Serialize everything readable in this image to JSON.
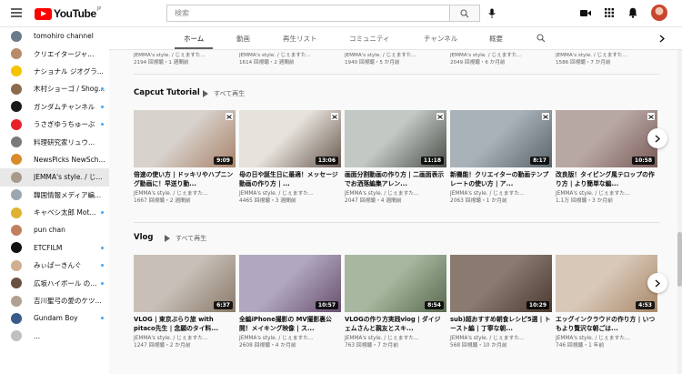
{
  "header": {
    "logo_text": "YouTube",
    "logo_country": "JP",
    "search_placeholder": "検索"
  },
  "sidebar": {
    "items": [
      {
        "label": "tomohiro channel",
        "color": "#6b7b8c",
        "dot": false
      },
      {
        "label": "クリエイタージャ...",
        "color": "#b78a6a",
        "dot": false
      },
      {
        "label": "ナショナル ジオグラ...",
        "color": "#f5c400",
        "dot": false
      },
      {
        "label": "木村ショーゴ / Shog...",
        "color": "#8c6a4e",
        "dot": true
      },
      {
        "label": "ガンダムチャンネル",
        "color": "#1a1a1a",
        "dot": true
      },
      {
        "label": "うさぎゆうちゅーぶ",
        "color": "#e8222a",
        "dot": true
      },
      {
        "label": "料理研究家リュウ...",
        "color": "#7a7a7a",
        "dot": false
      },
      {
        "label": "NewsPicks NewSch...",
        "color": "#d98a2a",
        "dot": false
      },
      {
        "label": "JEMMA's style. / じ...",
        "color": "#a89a8a",
        "dot": false
      },
      {
        "label": "韓国情報メディア編...",
        "color": "#9aa6b0",
        "dot": false
      },
      {
        "label": "キャベシ太郎 Mot...",
        "color": "#e0b030",
        "dot": true
      },
      {
        "label": "pun chan",
        "color": "#c08060",
        "dot": false
      },
      {
        "label": "ETCFILM",
        "color": "#111111",
        "dot": true
      },
      {
        "label": "みぃぱーきんぐ",
        "color": "#d0b090",
        "dot": true
      },
      {
        "label": "広坂ハイボール の...",
        "color": "#6a5040",
        "dot": true
      },
      {
        "label": "吉川聖弓の愛のケツ...",
        "color": "#b0a090",
        "dot": false
      },
      {
        "label": "Gundam Boy",
        "color": "#3a5a8a",
        "dot": true
      },
      {
        "label": "...",
        "color": "#c0c0c0",
        "dot": false
      }
    ]
  },
  "tabs": [
    "ホーム",
    "動画",
    "再生リスト",
    "コミュニティ",
    "チャンネル",
    "概要"
  ],
  "top_row": [
    {
      "line1": "JEMMA's style. / じぇますた...",
      "line2": "2194 回視聴・1 週間前"
    },
    {
      "line1": "JEMMA's style. / じぇますた...",
      "line2": "1614 回視聴・2 週間前"
    },
    {
      "line1": "JEMMA's style. / じぇますた...",
      "line2": "1940 回視聴・5 か月前"
    },
    {
      "line1": "JEMMA's style. / じぇますた...",
      "line2": "2049 回視聴・6 か月前"
    },
    {
      "line1": "JEMMA's style. / じぇますた...",
      "line2": "1586 回視聴・7 か月前"
    }
  ],
  "shelf1": {
    "title": "Capcut Tutorial",
    "play_all": "すべて再生",
    "videos": [
      {
        "title": "倍速の使い方 | ドッキリやハプニング動画に！早送り動...",
        "channel": "JEMMA's style. / じぇますた...",
        "meta": "1667 回視聴・2 週間前",
        "duration": "9:09",
        "c1": "#d8d2cc",
        "c2": "#a8826a"
      },
      {
        "title": "母の日や誕生日に最適！メッセージ動画の作り方 | ...",
        "channel": "JEMMA's style. / じぇますた...",
        "meta": "4465 回視聴・3 週間前",
        "duration": "13:06",
        "c1": "#e6e2dc",
        "c2": "#6a5a50"
      },
      {
        "title": "画面分割動画の作り方 | 二画面表示でお洒落編集アレン...",
        "channel": "JEMMA's style. / じぇますた...",
        "meta": "2047 回視聴・4 週間前",
        "duration": "11:18",
        "c1": "#c2c8c4",
        "c2": "#4a5048"
      },
      {
        "title": "新機能！クリエイターの動画テンプレートの使い方 | ア...",
        "channel": "JEMMA's style. / じぇますた...",
        "meta": "2063 回視聴・1 か月前",
        "duration": "8:17",
        "c1": "#a8b2b8",
        "c2": "#5a646a"
      },
      {
        "title": "改良版！タイピング風テロップの作り方 | より簡単な編...",
        "channel": "JEMMA's style. / じぇますた...",
        "meta": "1.1万 回視聴・3 か月前",
        "duration": "10:58",
        "c1": "#b8a8a4",
        "c2": "#7a5a58"
      }
    ]
  },
  "shelf2": {
    "title": "Vlog",
    "play_all": "すべて再生",
    "videos": [
      {
        "title": "VLOG | 東京ぶらり旅 with pitaco先生 | 念願のタイ料...",
        "channel": "JEMMA's style. / じぇますた...",
        "meta": "1247 回視聴・2 か月前",
        "duration": "6:37",
        "c1": "#c8c0b8",
        "c2": "#8a7a6a"
      },
      {
        "title": "全編iPhone撮影の MV撮影裏公開！メイキング映像 | ス...",
        "channel": "JEMMA's style. / じぇますた...",
        "meta": "2608 回視聴・4 か月前",
        "duration": "10:57",
        "c1": "#b0a8c0",
        "c2": "#6a5070"
      },
      {
        "title": "VLOGの作り方実践vlog | ダイジェムさんと親友とスキ...",
        "channel": "JEMMA's style. / じぇますた...",
        "meta": "763 回視聴・7 か月前",
        "duration": "8:54",
        "c1": "#a8b8a0",
        "c2": "#5a6a50"
      },
      {
        "title": "sub)超おすすめ朝食レシピ5選 | トースト編 | 丁寧な朝...",
        "channel": "JEMMA's style. / じぇますた...",
        "meta": "568 回視聴・10 か月前",
        "duration": "10:29",
        "c1": "#8a7a70",
        "c2": "#4a3a30"
      },
      {
        "title": "エッグインクラウドの作り方 | いつもより贅沢な朝ごは...",
        "channel": "JEMMA's style. / じぇますた...",
        "meta": "746 回視聴・1 年前",
        "duration": "4:53",
        "c1": "#d8c8b8",
        "c2": "#a88868"
      }
    ]
  },
  "colors": {
    "brand": "#ff0000",
    "accent": "#3ea6ff"
  }
}
